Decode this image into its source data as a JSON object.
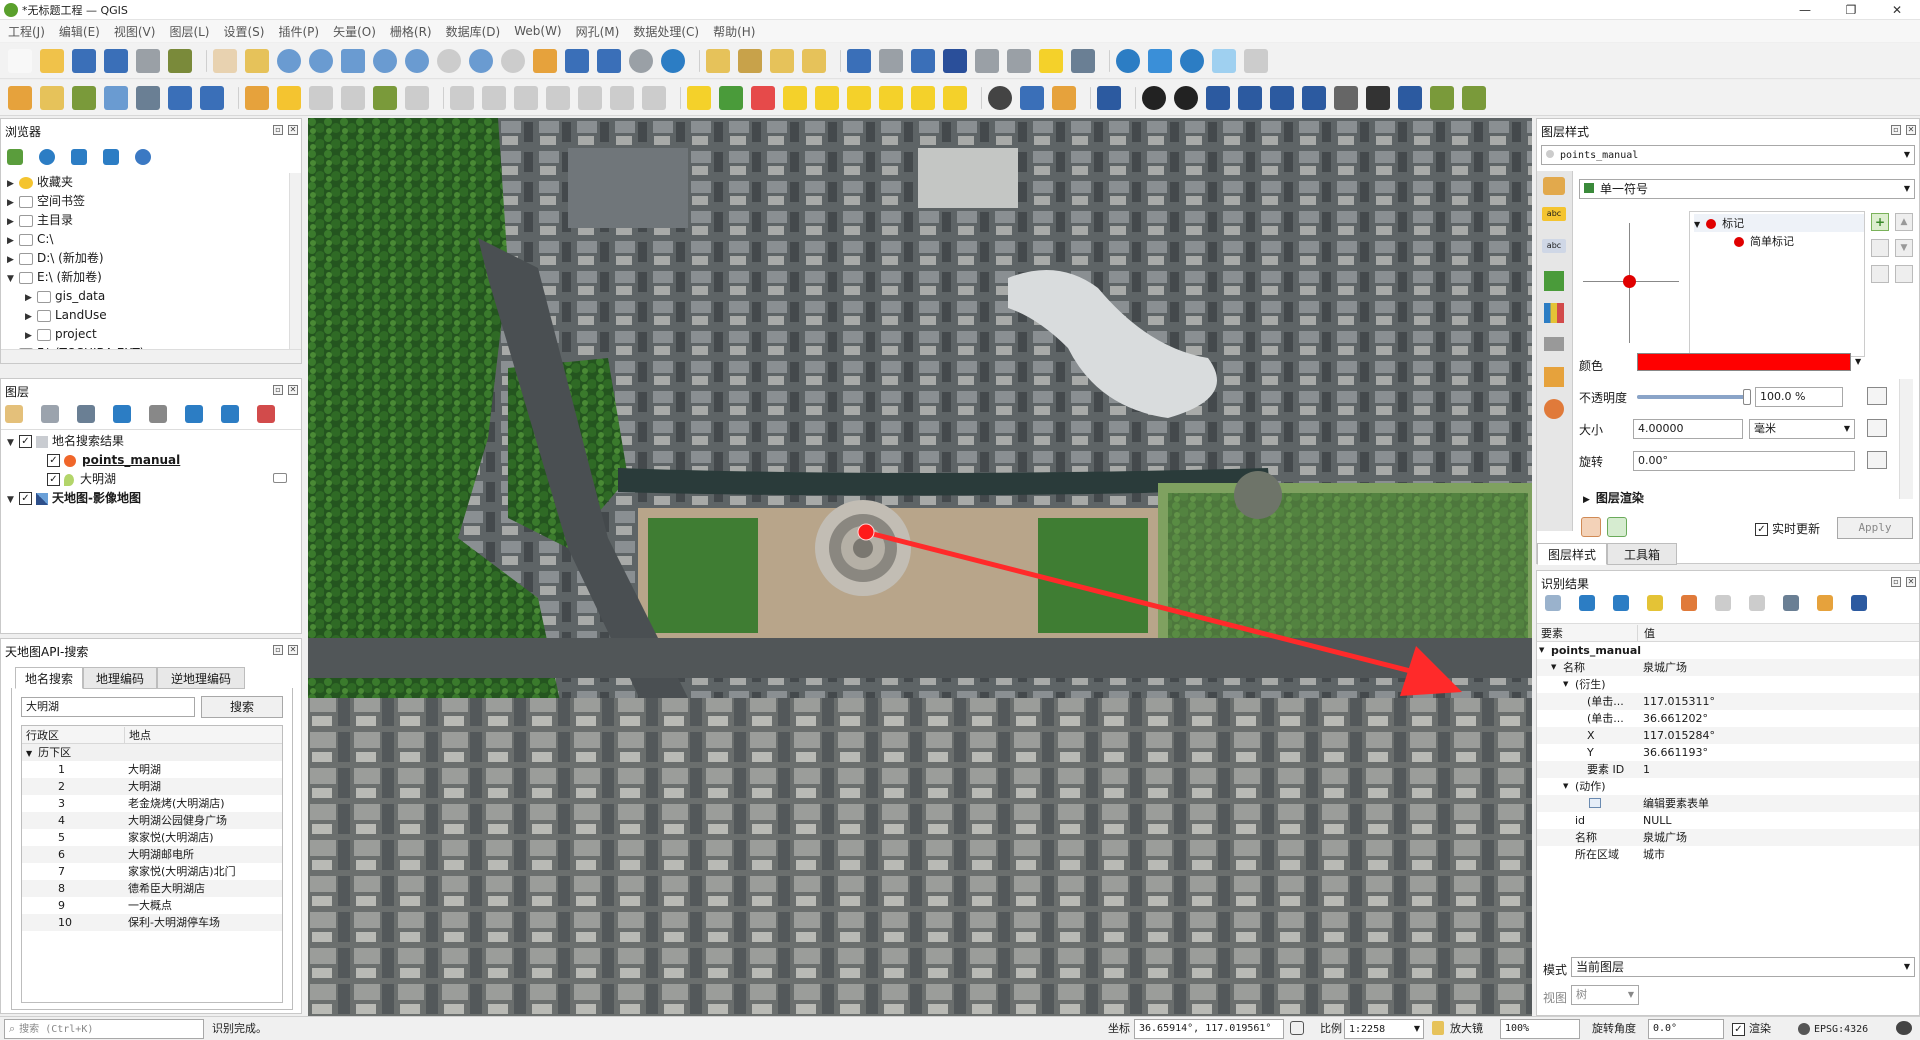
{
  "window": {
    "title": "*无标题工程 — QGIS"
  },
  "menu": [
    "工程(J)",
    "编辑(E)",
    "视图(V)",
    "图层(L)",
    "设置(S)",
    "插件(P)",
    "矢量(O)",
    "栅格(R)",
    "数据库(D)",
    "Web(W)",
    "网孔(M)",
    "数据处理(C)",
    "帮助(H)"
  ],
  "browser": {
    "title": "浏览器",
    "items": [
      "收藏夹",
      "空间书签",
      "主目录",
      "C:\\",
      "D:\\ (新加卷)",
      "E:\\ (新加卷)",
      "gis_data",
      "LandUse",
      "project",
      "F:\\ (TOSHIBA EXT)"
    ]
  },
  "layers": {
    "title": "图层",
    "group": "地名搜索结果",
    "items": [
      "points_manual",
      "大明湖",
      "天地图-影像地图"
    ]
  },
  "tianditu": {
    "title": "天地图API-搜索",
    "tabs": [
      "地名搜索",
      "地理编码",
      "逆地理编码"
    ],
    "search_value": "大明湖",
    "search_button": "搜索",
    "columns": [
      "行政区",
      "地点"
    ],
    "district": "历下区",
    "results": [
      {
        "no": "1",
        "name": "大明湖"
      },
      {
        "no": "2",
        "name": "大明湖"
      },
      {
        "no": "3",
        "name": "老金烧烤(大明湖店)"
      },
      {
        "no": "4",
        "name": "大明湖公园健身广场"
      },
      {
        "no": "5",
        "name": "家家悦(大明湖店)"
      },
      {
        "no": "6",
        "name": "大明湖邮电所"
      },
      {
        "no": "7",
        "name": "家家悦(大明湖店)北门"
      },
      {
        "no": "8",
        "name": "德希臣大明湖店"
      },
      {
        "no": "9",
        "name": "一大概点"
      },
      {
        "no": "10",
        "name": "保利-大明湖停车场"
      }
    ]
  },
  "style": {
    "title": "图层样式",
    "layer_select": "points_manual",
    "renderer": "单一符号",
    "symbol_tree": {
      "marker": "标记",
      "simple": "简单标记"
    },
    "color_label": "颜色",
    "color_value": "#ff0000",
    "opacity_label": "不透明度",
    "opacity_value": "100.0 %",
    "opacity_fraction": 1.0,
    "size_label": "大小",
    "size_value": "4.00000",
    "size_unit": "毫米",
    "rotation_label": "旋转",
    "rotation_value": "0.00°",
    "layer_render": "图层渲染",
    "live_update": "实时更新",
    "apply": "Apply",
    "bottom_tabs": [
      "图层样式",
      "工具箱"
    ]
  },
  "identify": {
    "title": "识别结果",
    "columns": [
      "要素",
      "值"
    ],
    "rows": [
      {
        "k": "points_manual",
        "v": ""
      },
      {
        "k": "名称",
        "v": "泉城广场"
      },
      {
        "k": "(衍生)",
        "v": ""
      },
      {
        "k": "(单击...",
        "v": "117.015311°"
      },
      {
        "k": "(单击...",
        "v": "36.661202°"
      },
      {
        "k": "X",
        "v": "117.015284°"
      },
      {
        "k": "Y",
        "v": "36.661193°"
      },
      {
        "k": "要素 ID",
        "v": "1"
      },
      {
        "k": "(动作)",
        "v": ""
      },
      {
        "k": "",
        "v": "编辑要素表单"
      },
      {
        "k": "id",
        "v": "NULL"
      },
      {
        "k": "名称",
        "v": "泉城广场"
      },
      {
        "k": "所在区域",
        "v": "城市"
      }
    ],
    "mode_label": "模式",
    "mode_value": "当前图层",
    "view_label": "视图",
    "view_value": "树"
  },
  "status": {
    "search_placeholder": "搜索 (Ctrl+K)",
    "message": "识别完成。",
    "coord_label": "坐标",
    "coord_value": "36.65914°, 117.019561°",
    "scale_label": "比例",
    "scale_value": "1:2258",
    "magnifier_label": "放大镜",
    "magnifier_value": "100%",
    "rotation_label": "旋转角度",
    "rotation_value": "0.0°",
    "render_label": "渲染",
    "crs": "EPSG:4326"
  },
  "colors": {
    "accent": "#ff0000",
    "link": "#1a5fb4"
  }
}
